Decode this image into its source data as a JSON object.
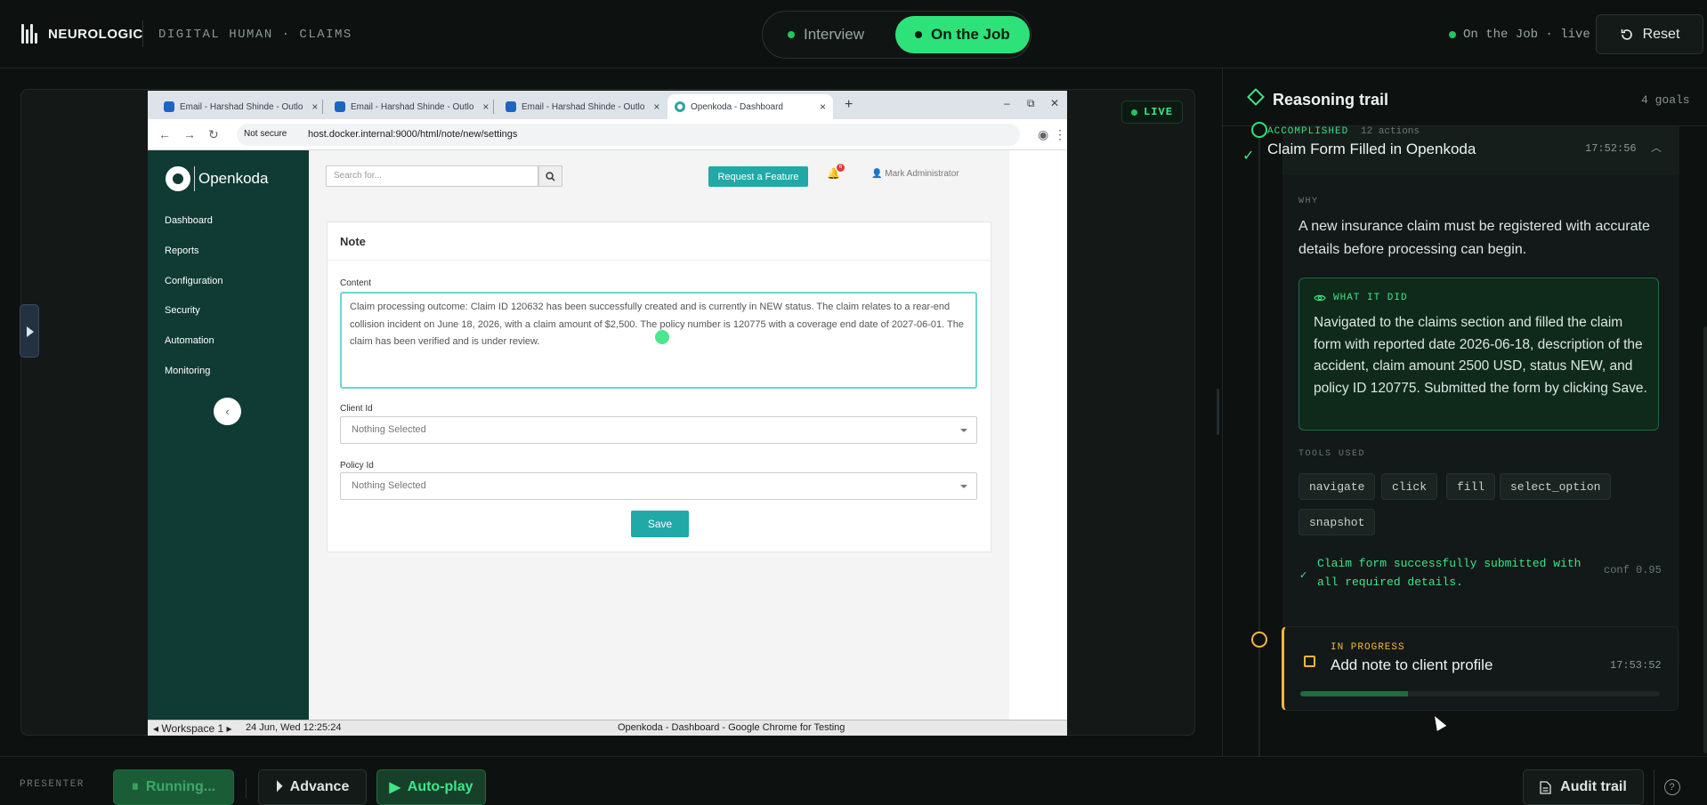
{
  "header": {
    "brand": "NEUROLOGIC",
    "subtitle": "DIGITAL HUMAN · CLAIMS",
    "modes": [
      "Interview",
      "On the Job"
    ],
    "status": "On the Job · live",
    "reset_label": "Reset",
    "live_badge": "LIVE"
  },
  "browser": {
    "tabs": [
      {
        "label": "Email - Harshad Shinde - Outlo"
      },
      {
        "label": "Email - Harshad Shinde - Outlo"
      },
      {
        "label": "Email - Harshad Shinde - Outlo"
      },
      {
        "label": "Openkoda - Dashboard"
      }
    ],
    "not_secure": "Not secure",
    "url": "host.docker.internal:9000/html/note/new/settings",
    "taskbar": {
      "workspace": "◂ Workspace 1 ▸",
      "datetime": "24 Jun, Wed 12:25:24",
      "window_title": "Openkoda - Dashboard - Google Chrome for Testing"
    }
  },
  "app": {
    "logo": "Openkoda",
    "nav": [
      "Dashboard",
      "Reports",
      "Configuration",
      "Security",
      "Automation",
      "Monitoring"
    ],
    "search_placeholder": "Search for...",
    "request_feature": "Request a Feature",
    "notif_count": "6",
    "user": "Mark Administrator",
    "form": {
      "title": "Note",
      "content_label": "Content",
      "content_value": "Claim processing outcome: Claim ID 120632 has been successfully created and is currently in NEW status. The claim relates to a rear-end collision incident on June 18, 2026, with a claim amount of $2,500. The policy number is 120775 with a coverage end date of 2027-06-01. The claim has been verified and is under review.",
      "client_label": "Client Id",
      "client_value": "Nothing Selected",
      "policy_label": "Policy Id",
      "policy_value": "Nothing Selected",
      "save_label": "Save"
    }
  },
  "trail": {
    "title": "Reasoning trail",
    "count": "4 goals",
    "goal1": {
      "state": "ACCOMPLISHED",
      "actions": "12 actions",
      "title": "Claim Form Filled in Openkoda",
      "time": "17:52:56",
      "why_label": "WHY",
      "why": "A new insurance claim must be registered with accurate details before processing can begin.",
      "did_label": "WHAT IT DID",
      "did": "Navigated to the claims section and filled the claim form with reported date 2026-06-18, description of the accident, claim amount 2500 USD, status NEW, and policy ID 120775. Submitted the form by clicking Save.",
      "tools_label": "TOOLS USED",
      "tools": [
        "navigate",
        "click",
        "fill",
        "select_option",
        "snapshot"
      ],
      "outcome": "Claim form successfully submitted with all required details.",
      "conf": "conf 0.95"
    },
    "goal2": {
      "state": "IN PROGRESS",
      "title": "Add note to client profile",
      "time": "17:53:52",
      "progress": 0.3
    }
  },
  "footer": {
    "presenter": "PRESENTER",
    "running": "Running...",
    "advance": "Advance",
    "autoplay": "Auto-play",
    "audit": "Audit trail"
  },
  "colors": {
    "accent": "#2ee27a",
    "in_progress": "#f4b740",
    "app_primary": "#20a9a6",
    "app_sidebar": "#0f3b34"
  }
}
